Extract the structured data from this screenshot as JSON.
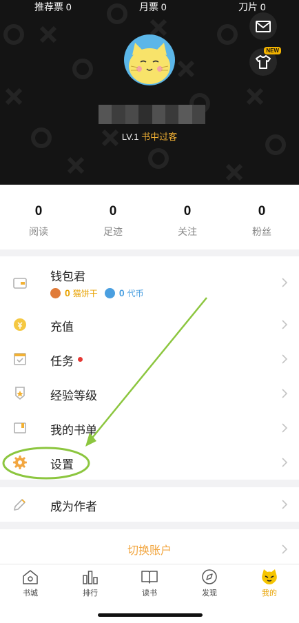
{
  "header": {
    "new_badge": "NEW",
    "level_prefix": "LV.1",
    "level_title": "书中过客",
    "stats": [
      {
        "label": "推荐票 0"
      },
      {
        "label": "月票 0"
      },
      {
        "label": "刀片 0"
      }
    ]
  },
  "counters": [
    {
      "value": "0",
      "label": "阅读"
    },
    {
      "value": "0",
      "label": "足迹"
    },
    {
      "value": "0",
      "label": "关注"
    },
    {
      "value": "0",
      "label": "粉丝"
    }
  ],
  "wallet": {
    "label": "钱包君",
    "cat_value": "0",
    "cat_unit": "猫饼干",
    "coin_value": "0",
    "coin_unit": "代币"
  },
  "menu": {
    "recharge": "充值",
    "tasks": "任务",
    "experience": "经验等级",
    "booklist": "我的书单",
    "settings": "设置"
  },
  "author": {
    "label": "成为作者"
  },
  "switch_account": {
    "label": "切换账户"
  },
  "tabs": [
    {
      "label": "书城"
    },
    {
      "label": "排行"
    },
    {
      "label": "读书"
    },
    {
      "label": "发现"
    },
    {
      "label": "我的"
    }
  ],
  "colors": {
    "accent": "#f2a640",
    "level_title": "#f2b134",
    "annotation": "#8cc63f",
    "dot": "#e53935",
    "cat_coin": "#e07b39",
    "token_coin": "#4a9fe0"
  }
}
